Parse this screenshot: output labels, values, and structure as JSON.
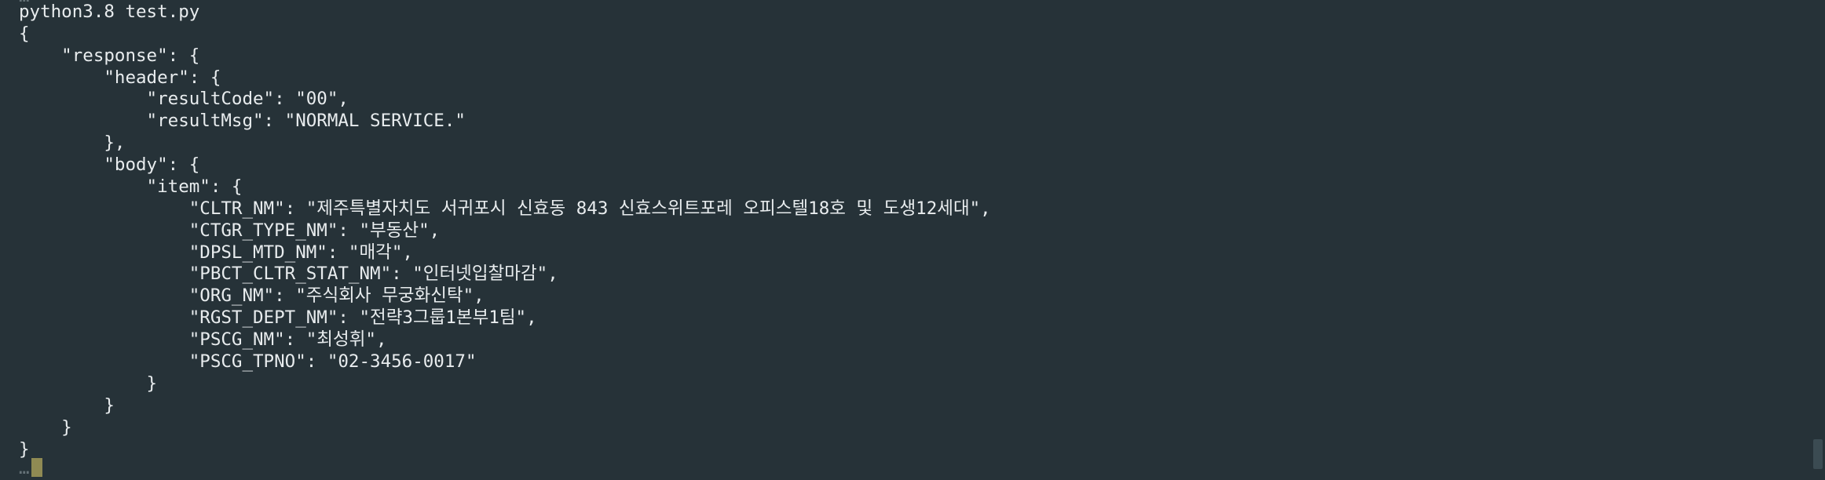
{
  "terminal": {
    "top_clipped_fragment": "…",
    "command": "python3.8 test.py",
    "output_lines": [
      "{",
      "    \"response\": {",
      "        \"header\": {",
      "            \"resultCode\": \"00\",",
      "            \"resultMsg\": \"NORMAL SERVICE.\"",
      "        },",
      "        \"body\": {",
      "            \"item\": {",
      "                \"CLTR_NM\": \"제주특별자치도 서귀포시 신효동 843 신효스위트포레 오피스텔18호 및 도생12세대\",",
      "                \"CTGR_TYPE_NM\": \"부동산\",",
      "                \"DPSL_MTD_NM\": \"매각\",",
      "                \"PBCT_CLTR_STAT_NM\": \"인터넷입찰마감\",",
      "                \"ORG_NM\": \"주식회사 무궁화신탁\",",
      "                \"RGST_DEPT_NM\": \"전략3그룹1본부1팀\",",
      "                \"PSCG_NM\": \"최성휘\",",
      "                \"PSCG_TPNO\": \"02-3456-0017\"",
      "            }",
      "        }",
      "    }",
      "}"
    ],
    "bottom_clipped_prompt": "…"
  },
  "colors": {
    "background": "#263238",
    "text": "#e8ecee",
    "cursor": "#e6d36a"
  }
}
